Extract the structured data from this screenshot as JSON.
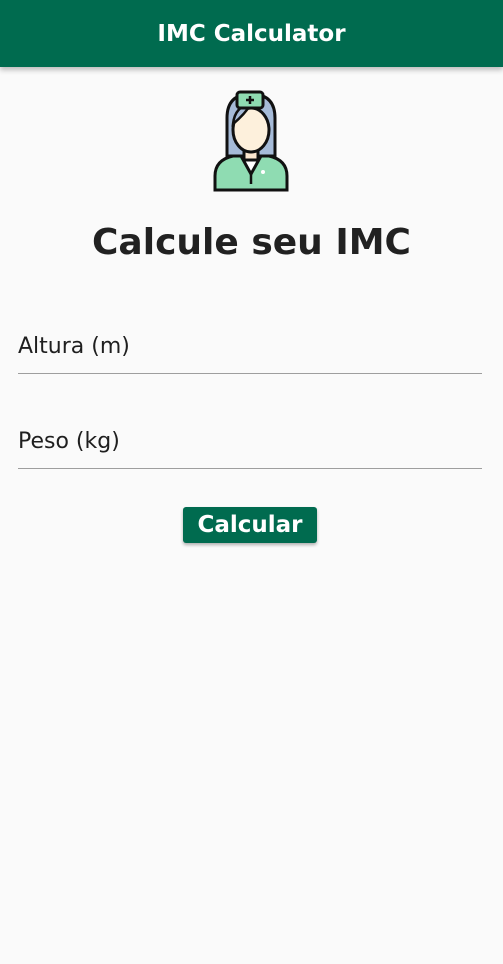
{
  "appbar": {
    "title": "IMC Calculator"
  },
  "avatar": {
    "icon": "nurse-avatar-icon"
  },
  "main": {
    "heading": "Calcule seu IMC",
    "altura_placeholder": "Altura (m)",
    "peso_placeholder": "Peso (kg)",
    "calc_label": "Calcular"
  },
  "colors": {
    "primary": "#006b4f",
    "background": "#fafafa",
    "text": "#212121"
  }
}
